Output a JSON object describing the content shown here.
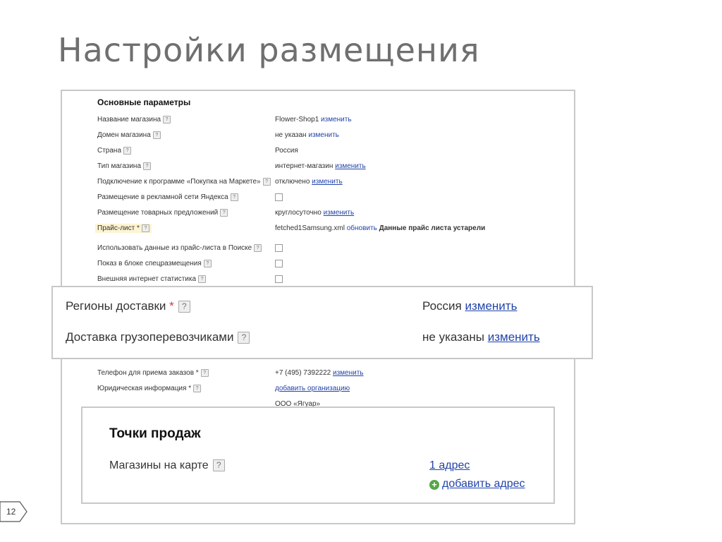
{
  "slide": {
    "title": "Настройки размещения",
    "page_number": "12"
  },
  "main": {
    "section_title": "Основные параметры",
    "rows": [
      {
        "label": "Название магазина",
        "value": "Flower-Shop1",
        "link": "изменить"
      },
      {
        "label": "Домен магазина",
        "value": "не указан",
        "link": "изменить"
      },
      {
        "label": "Страна",
        "value": "Россия"
      },
      {
        "label": "Тип магазина",
        "value": "интернет-магазин",
        "link": "изменить"
      },
      {
        "label": "Подключение к программе «Покупка на Маркете»",
        "value": "отключено",
        "link": "изменить"
      },
      {
        "label": "Размещение в рекламной сети Яндекса"
      },
      {
        "label": "Размещение товарных предложений",
        "value": "круглосуточно",
        "link": "изменить"
      },
      {
        "label": "Прайс-лист *",
        "value": "fetched1Samsung.xml",
        "link": "обновить",
        "note": "Данные прайс листа устарели"
      },
      {
        "label": "Использовать данные из прайс-листа в Поиске"
      },
      {
        "label": "Показ в блоке спецразмещения"
      },
      {
        "label": "Внешняя интернет статистика"
      }
    ],
    "lower_rows": [
      {
        "label": "Телефон для приема заказов *",
        "value": "+7 (495) 7392222",
        "link": "изменить"
      },
      {
        "label": "Юридическая информация *",
        "link": "добавить организацию"
      },
      {
        "value": "ООО «Ягуар»"
      }
    ]
  },
  "delivery": {
    "regions_label": "Регионы доставки",
    "regions_required": "*",
    "regions_value": "Россия",
    "regions_link": "изменить",
    "carriers_label": "Доставка грузоперевозчиками",
    "carriers_value": "не указаны",
    "carriers_link": "изменить"
  },
  "stores": {
    "title": "Точки продаж",
    "map_label": "Магазины на карте",
    "count_link": "1 адрес",
    "add_link": "добавить адрес"
  },
  "help_glyph": "?",
  "colors": {
    "link": "#2244aa",
    "highlight": "#fdf4d2",
    "frame_border": "#c8c8c8",
    "add_icon": "#55a647"
  }
}
